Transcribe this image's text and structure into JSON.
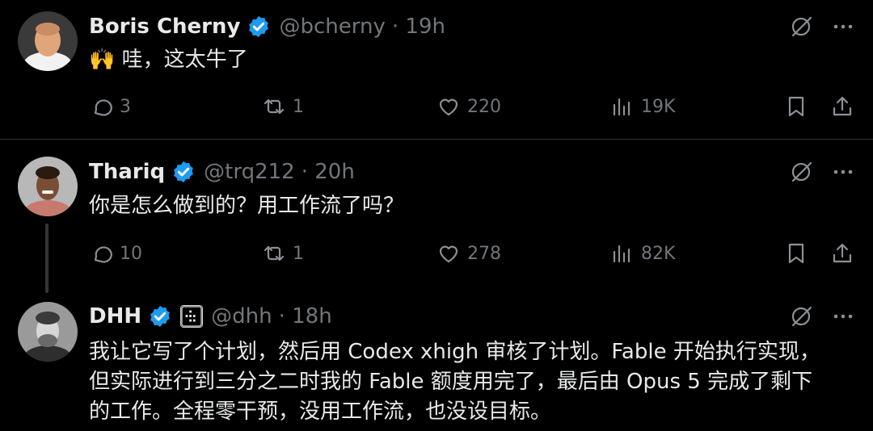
{
  "tweets": [
    {
      "name": "Boris Cherny",
      "handle": "@bcherny",
      "time": "· 19h",
      "text": "🙌 哇，这太牛了",
      "stats": {
        "replies": "3",
        "reposts": "1",
        "likes": "220",
        "views": "19K"
      }
    },
    {
      "name": "Thariq",
      "handle": "@trq212",
      "time": "· 20h",
      "text": "你是怎么做到的？用工作流了吗？",
      "stats": {
        "replies": "10",
        "reposts": "1",
        "likes": "278",
        "views": "82K"
      }
    },
    {
      "name": "DHH",
      "handle": "@dhh",
      "time": "· 18h",
      "text_lines": [
        "我让它写了个计划，然后用 Codex xhigh 审核了计划。Fable 开始执行实现，",
        "但实际进行到三分之二时我的 Fable 额度用完了，最后由 Opus 5 完成了剩下",
        "的工作。全程零干预，没用工作流，也没设目标。"
      ]
    }
  ],
  "colors": {
    "verified": "#1d9bf0",
    "muted": "#71767b",
    "text": "#e7e9ea",
    "background": "#000000"
  },
  "icons": [
    "verified-badge-icon",
    "grok-icon",
    "more-icon",
    "reply-icon",
    "repost-icon",
    "like-icon",
    "views-icon",
    "bookmark-icon",
    "share-icon",
    "affiliate-badge-icon"
  ]
}
